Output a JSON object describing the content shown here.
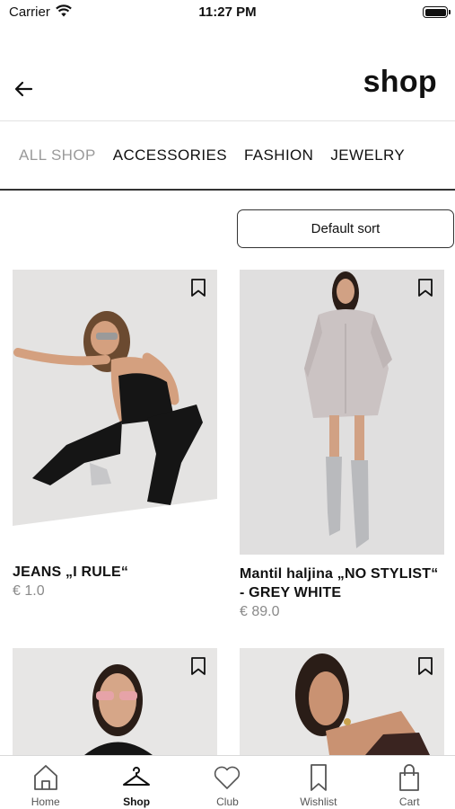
{
  "status_bar": {
    "carrier": "Carrier",
    "time": "11:27 PM"
  },
  "header": {
    "title": "shop"
  },
  "categories": [
    "ALL SHOP",
    "ACCESSORIES",
    "FASHION",
    "JEWELRY"
  ],
  "sort": {
    "label": "Default sort"
  },
  "products": [
    {
      "name": "JEANS „I RULE“",
      "price": "€ 1.0"
    },
    {
      "name": "Mantil haljina „NO STYLIST“ - GREY WHITE",
      "price": "€ 89.0"
    },
    {
      "name": "",
      "price": ""
    },
    {
      "name": "",
      "price": ""
    }
  ],
  "tabbar": [
    {
      "label": "Home",
      "icon": "home-icon"
    },
    {
      "label": "Shop",
      "icon": "hanger-icon"
    },
    {
      "label": "Club",
      "icon": "heart-icon"
    },
    {
      "label": "Wishlist",
      "icon": "bookmark-icon"
    },
    {
      "label": "Cart",
      "icon": "shopping-bag-icon"
    }
  ],
  "colors": {
    "active_tab": "#9a9a9a",
    "price": "#8a8a8a",
    "photo_bg": "#e4e3e2"
  }
}
